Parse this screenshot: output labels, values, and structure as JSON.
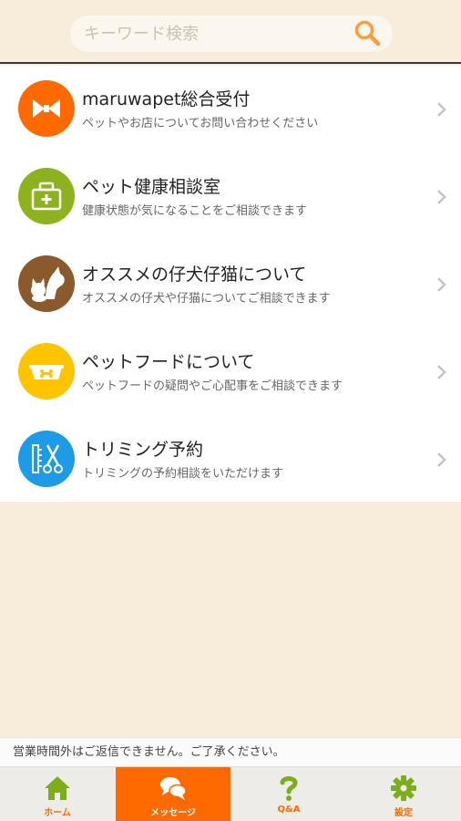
{
  "search": {
    "placeholder": "キーワード検索"
  },
  "colors": {
    "accent": "#ff6a00",
    "background": "#f7edda",
    "icon_orange": "#ff6a00",
    "icon_green": "#8cb21e",
    "icon_brown": "#8a5a2c",
    "icon_yellow": "#ffc400",
    "icon_blue": "#1e9be6",
    "tab_green": "#7cae1c"
  },
  "menu": {
    "items": [
      {
        "title": "maruwapet総合受付",
        "subtitle": "ペットやお店についてお問い合わせください",
        "icon": "bowtie-icon"
      },
      {
        "title": "ペット健康相談室",
        "subtitle": "健康状態が気になることをご相談できます",
        "icon": "medical-kit-icon"
      },
      {
        "title": "オススメの仔犬仔猫について",
        "subtitle": "オススメの仔犬や仔猫についてご相談できます",
        "icon": "dog-cat-icon"
      },
      {
        "title": "ペットフードについて",
        "subtitle": "ペットフードの疑問やご心配事をご相談できます",
        "icon": "pet-bowl-icon"
      },
      {
        "title": "トリミング予約",
        "subtitle": "トリミングの予約相談をいただけます",
        "icon": "scissors-comb-icon"
      }
    ]
  },
  "notice": "営業時間外はご返信できません。ご了承ください。",
  "tabs": [
    {
      "label": "ホーム",
      "icon": "home-icon"
    },
    {
      "label": "メッセージ",
      "icon": "chat-bubbles-icon",
      "active": true
    },
    {
      "label": "Q&A",
      "icon": "question-mark-icon"
    },
    {
      "label": "設定",
      "icon": "gear-icon"
    }
  ]
}
